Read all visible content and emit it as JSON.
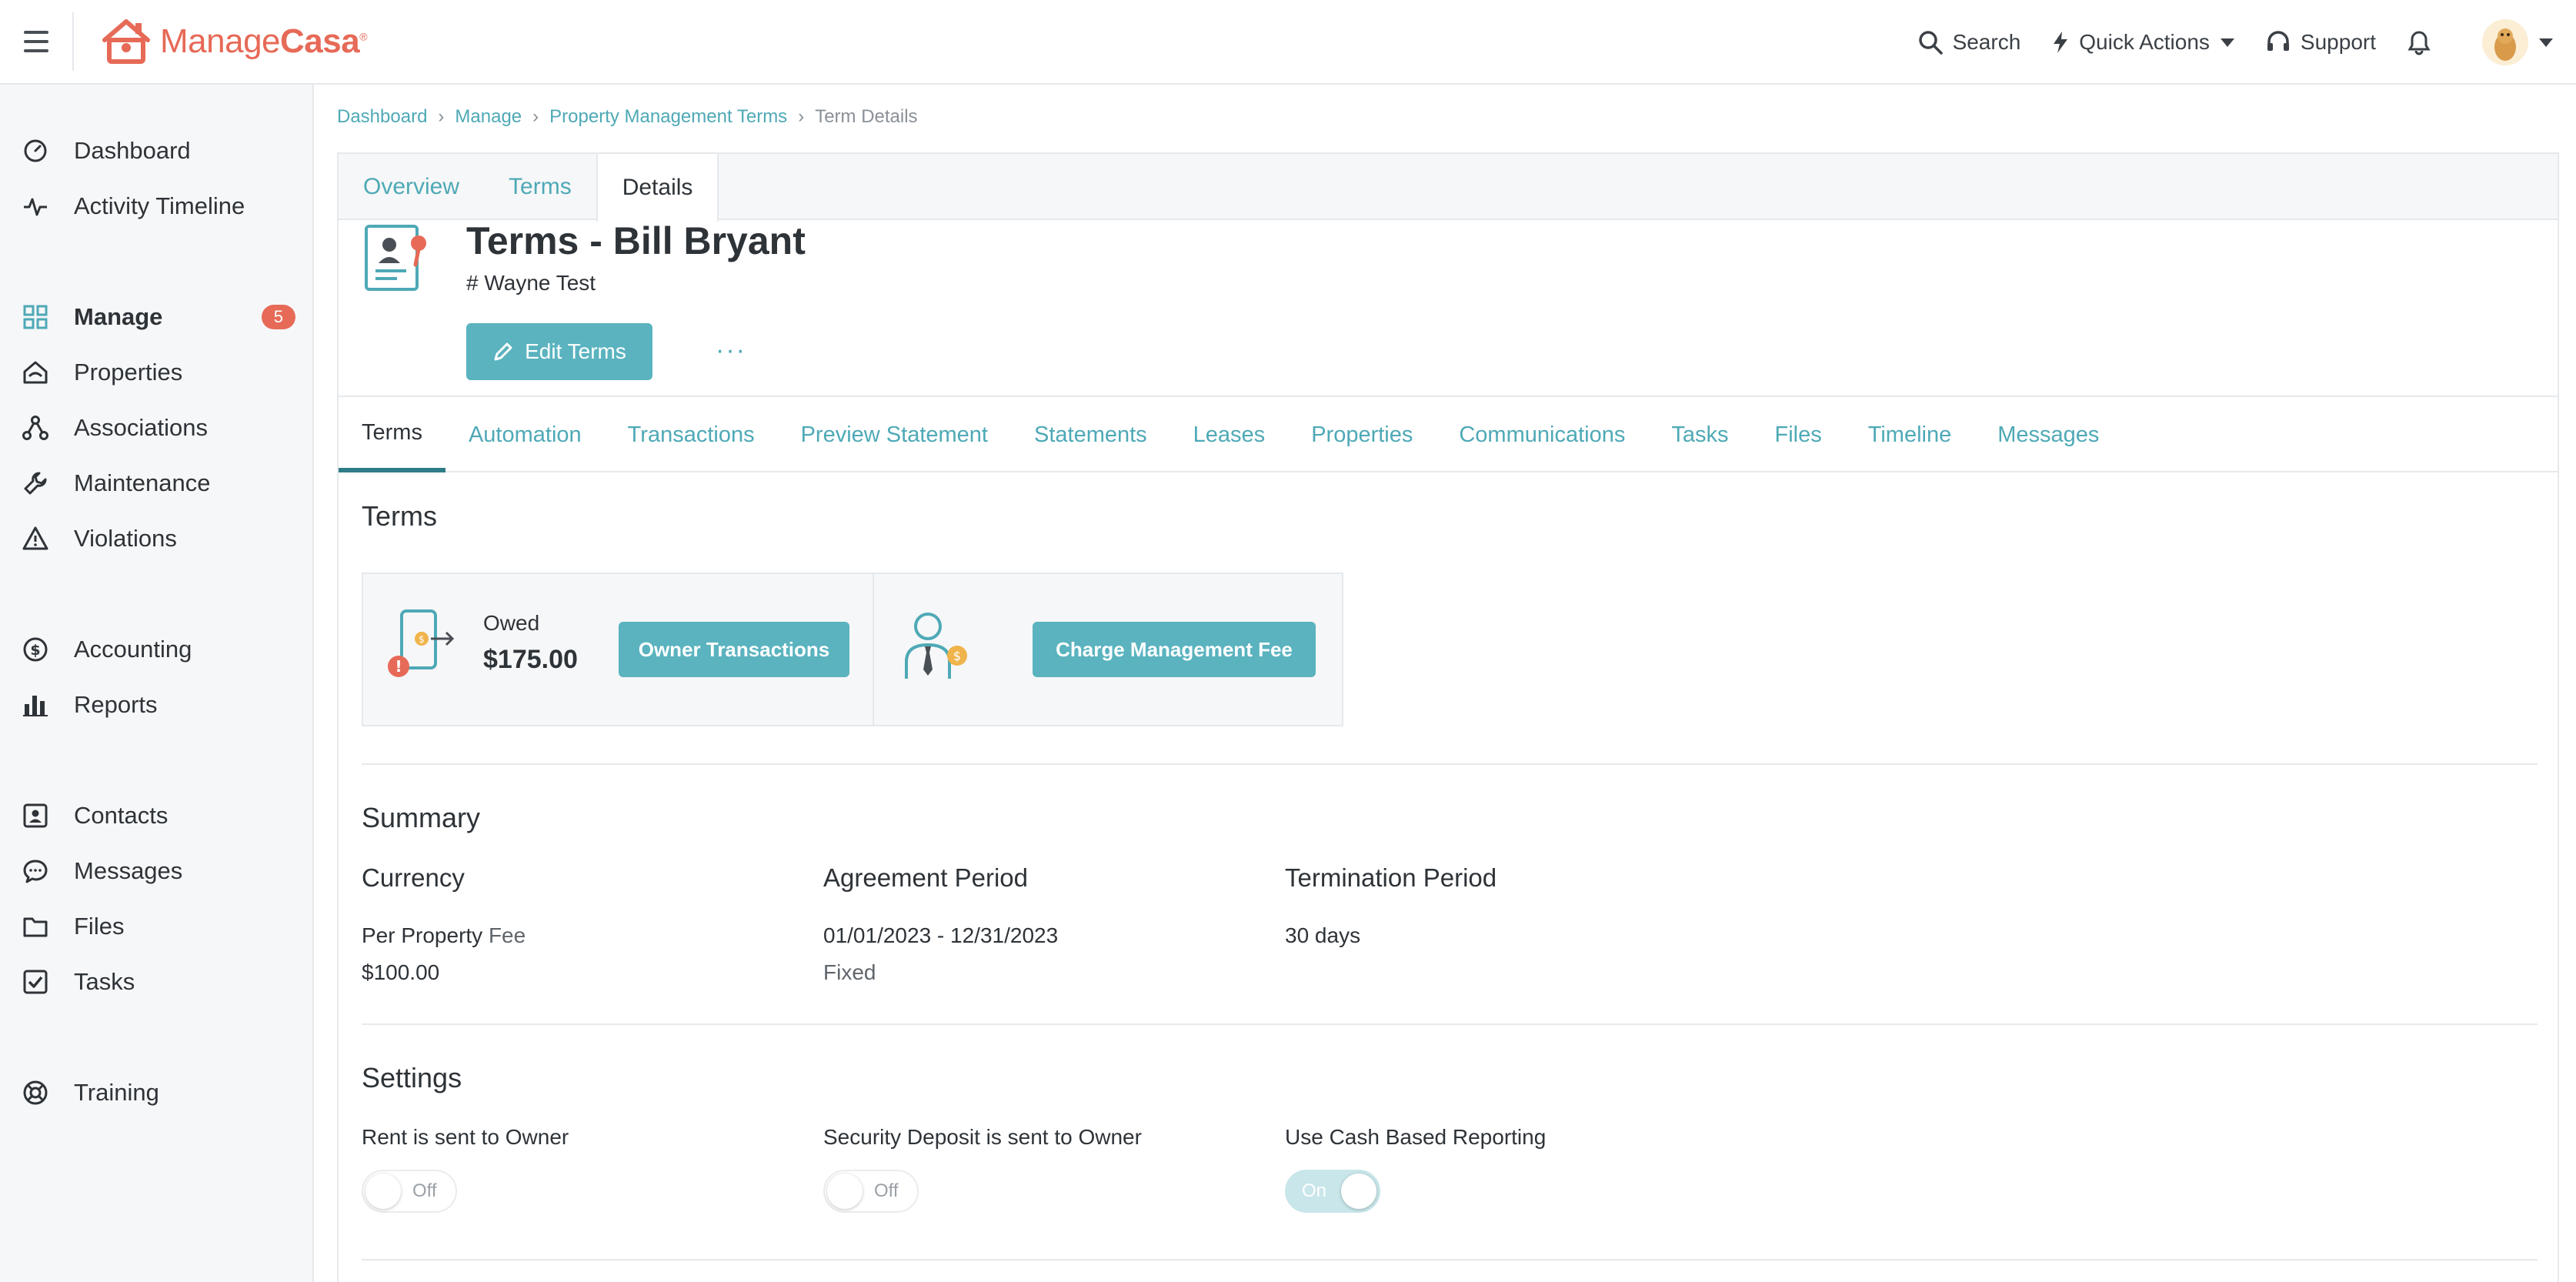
{
  "app": {
    "brand_light": "Manage",
    "brand_bold": "Casa",
    "brand_mark": "®",
    "brand_color": "#e66a57",
    "accent_color": "#5ab3bf"
  },
  "topbar": {
    "search_label": "Search",
    "quick_actions_label": "Quick Actions",
    "support_label": "Support"
  },
  "sidebar": {
    "items": [
      {
        "label": "Dashboard",
        "icon": "dashboard-gauge-icon"
      },
      {
        "label": "Activity Timeline",
        "icon": "activity-pulse-icon"
      },
      {
        "label": "Manage",
        "icon": "grid-icon",
        "badge": "5"
      },
      {
        "label": "Properties",
        "icon": "house-icon"
      },
      {
        "label": "Associations",
        "icon": "network-icon"
      },
      {
        "label": "Maintenance",
        "icon": "wrench-icon"
      },
      {
        "label": "Violations",
        "icon": "warning-icon"
      },
      {
        "label": "Accounting",
        "icon": "dollar-circle-icon"
      },
      {
        "label": "Reports",
        "icon": "bar-chart-icon"
      },
      {
        "label": "Contacts",
        "icon": "contact-card-icon"
      },
      {
        "label": "Messages",
        "icon": "chat-bubble-icon"
      },
      {
        "label": "Files",
        "icon": "folder-icon"
      },
      {
        "label": "Tasks",
        "icon": "checkbox-icon"
      },
      {
        "label": "Training",
        "icon": "lifebuoy-icon"
      }
    ]
  },
  "breadcrumb": {
    "items": [
      "Dashboard",
      "Manage",
      "Property Management Terms"
    ],
    "current": "Term Details"
  },
  "top_tabs": [
    "Overview",
    "Terms",
    "Details"
  ],
  "term": {
    "title": "Terms - Bill Bryant",
    "subtitle": "# Wayne Test",
    "edit_label": "Edit Terms",
    "more_label": "···"
  },
  "sub_tabs": [
    "Terms",
    "Automation",
    "Transactions",
    "Preview Statement",
    "Statements",
    "Leases",
    "Properties",
    "Communications",
    "Tasks",
    "Files",
    "Timeline",
    "Messages"
  ],
  "terms_section": {
    "title": "Terms",
    "owed_label": "Owed",
    "owed_value": "$175.00",
    "owner_transactions_label": "Owner Transactions",
    "charge_fee_label": "Charge Management Fee"
  },
  "summary": {
    "title": "Summary",
    "currency_header": "Currency",
    "fee_label_a": "Per Property",
    "fee_label_b": " Fee",
    "fee_value": "$100.00",
    "agreement_header": "Agreement Period",
    "agreement_dates": "01/01/2023 - 12/31/2023",
    "agreement_type": "Fixed",
    "termination_header": "Termination Period",
    "termination_value": "30 days"
  },
  "settings": {
    "title": "Settings",
    "toggles": [
      {
        "label": "Rent is sent to Owner",
        "state": "Off"
      },
      {
        "label": "Security Deposit is sent to Owner",
        "state": "Off"
      },
      {
        "label": "Use Cash Based Reporting",
        "state": "On"
      }
    ]
  }
}
